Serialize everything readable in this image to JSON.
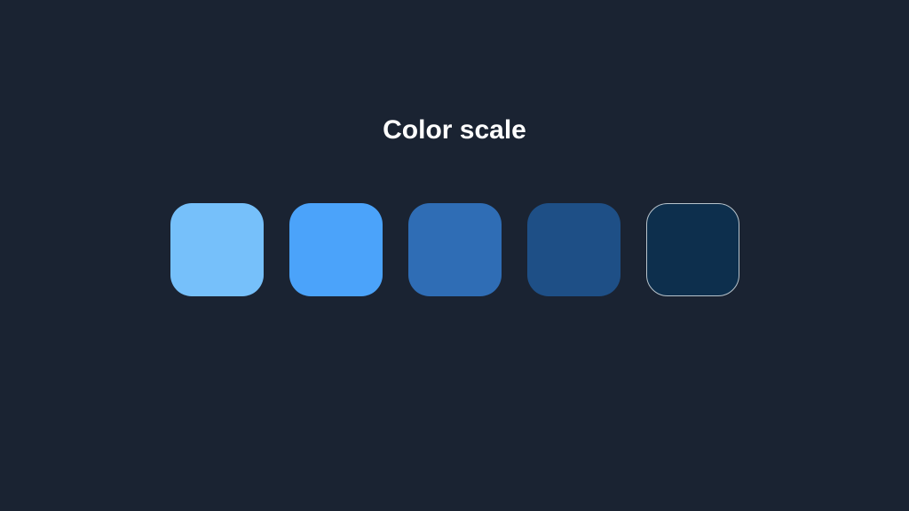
{
  "title": "Color scale",
  "colors": {
    "background": "#1a2332",
    "swatches": [
      {
        "hex": "#76c0fa",
        "outlined": false
      },
      {
        "hex": "#4ba3fa",
        "outlined": false
      },
      {
        "hex": "#2f6db5",
        "outlined": false
      },
      {
        "hex": "#1e4f86",
        "outlined": false
      },
      {
        "hex": "#0d2f4d",
        "outlined": true
      }
    ]
  }
}
